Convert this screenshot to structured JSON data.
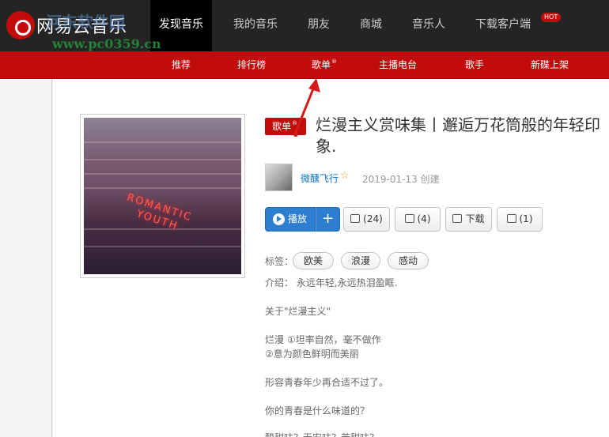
{
  "topnav": {
    "brand": "网易云音乐",
    "items": [
      "发现音乐",
      "我的音乐",
      "朋友",
      "商城",
      "音乐人",
      "下载客户端"
    ],
    "hot_badge": "HOT"
  },
  "watermark": {
    "line1": "河东软件园",
    "line2": "www.pc0359.cn"
  },
  "subnav": {
    "items": [
      "推荐",
      "排行榜",
      "歌单",
      "主播电台",
      "歌手",
      "新碟上架"
    ],
    "superscript": "®"
  },
  "playlist": {
    "badge": "歌单",
    "badge_sup": "®",
    "title": "烂漫主义赏味集丨邂逅万花筒般的年轻印象.",
    "cover_text_line1": "ROMANTIC",
    "cover_text_line2": "YOUTH",
    "creator": "微醺飞行",
    "created": "2019-01-13 创建",
    "buttons": {
      "play": "播放",
      "add": "+",
      "collect": "(24)",
      "share": "(4)",
      "download": "下载",
      "comment": "(1)"
    },
    "tags_label": "标签：",
    "tags": [
      "欧美",
      "浪漫",
      "感动"
    ],
    "intro": [
      "介绍： 永远年轻,永远热泪盈眶.",
      "关于\"烂漫主义\"",
      "烂漫 ①坦率自然，毫不做作",
      "②意为颜色鲜明而美丽",
      "形容青春年少再合适不过了。",
      "你的青春是什么味道的？",
      "酸甜味？无安味？苦甜味？"
    ]
  },
  "colors": {
    "topbar": "#242424",
    "accent_red": "#c20c0c",
    "play_blue": "#2c7fd0",
    "link_blue": "#0c73c2"
  },
  "icons": [
    "logo-icon",
    "play-icon",
    "collect-icon",
    "share-icon",
    "download-icon",
    "comment-icon",
    "star-icon",
    "annotation-arrow"
  ]
}
